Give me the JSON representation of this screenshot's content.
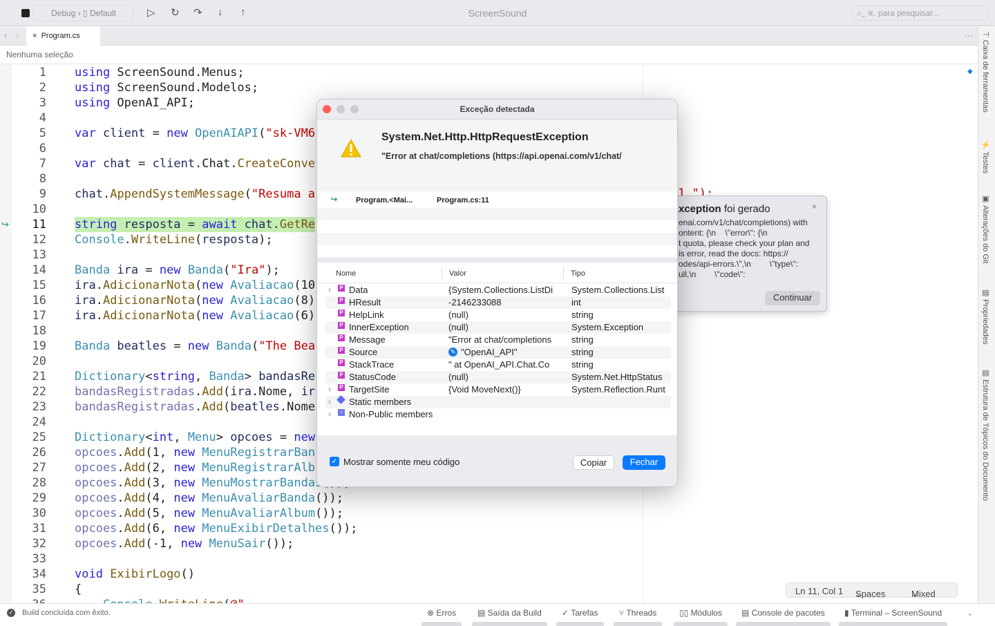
{
  "toolbar": {
    "config": "Debug",
    "device": "Default",
    "title": "ScreenSound",
    "search_placeholder": "⌘. para pesquisar..."
  },
  "tabs": [
    {
      "label": "Program.cs",
      "close": "×"
    }
  ],
  "breadcrumb": "Nenhuma seleção",
  "more_label": "···",
  "editor": {
    "current_line": 11,
    "line_numbers": [
      "1",
      "2",
      "3",
      "4",
      "5",
      "6",
      "7",
      "8",
      "9",
      "10",
      "11",
      "12",
      "13",
      "14",
      "15",
      "16",
      "17",
      "18",
      "19",
      "20",
      "21",
      "22",
      "23",
      "24",
      "25",
      "26",
      "27",
      "28",
      "29",
      "30",
      "31",
      "32",
      "33",
      "34",
      "35",
      "36"
    ],
    "lines": [
      [
        [
          "k",
          "using"
        ],
        [
          "n",
          " ScreenSound.Menus;"
        ]
      ],
      [
        [
          "k",
          "using"
        ],
        [
          "n",
          " ScreenSound.Modelos;"
        ]
      ],
      [
        [
          "k",
          "using"
        ],
        [
          "n",
          " OpenAI_API;"
        ]
      ],
      [],
      [
        [
          "k",
          "var"
        ],
        [
          "i",
          " client"
        ],
        [
          "p",
          " = "
        ],
        [
          "k",
          "new"
        ],
        [
          "t",
          " OpenAIAPI"
        ],
        [
          "p",
          "("
        ],
        [
          "s",
          "\"sk-VM6"
        ]
      ],
      [],
      [
        [
          "k",
          "var"
        ],
        [
          "i",
          " chat"
        ],
        [
          "p",
          " = "
        ],
        [
          "i",
          "client"
        ],
        [
          "p",
          ".Chat."
        ],
        [
          "m",
          "CreateConve"
        ]
      ],
      [],
      [
        [
          "i",
          "chat"
        ],
        [
          "p",
          "."
        ],
        [
          "m",
          "AppendSystemMessage"
        ],
        [
          "p",
          "("
        ],
        [
          "s",
          "\"Resuma a"
        ]
      ],
      [],
      [
        [
          "k",
          "string"
        ],
        [
          "i",
          " resposta"
        ],
        [
          "p",
          " = "
        ],
        [
          "k",
          "await"
        ],
        [
          "i",
          " chat"
        ],
        [
          "p",
          "."
        ],
        [
          "m",
          "GetRe"
        ]
      ],
      [
        [
          "t",
          "Console"
        ],
        [
          "p",
          "."
        ],
        [
          "m",
          "WriteLine"
        ],
        [
          "p",
          "("
        ],
        [
          "i",
          "resposta"
        ],
        [
          "p",
          ");"
        ]
      ],
      [],
      [
        [
          "t",
          "Banda"
        ],
        [
          "i",
          " ira"
        ],
        [
          "p",
          " = "
        ],
        [
          "k",
          "new"
        ],
        [
          "t",
          " Banda"
        ],
        [
          "p",
          "("
        ],
        [
          "s",
          "\"Ira\""
        ],
        [
          "p",
          ");"
        ]
      ],
      [
        [
          "i",
          "ira"
        ],
        [
          "p",
          "."
        ],
        [
          "m",
          "AdicionarNota"
        ],
        [
          "p",
          "("
        ],
        [
          "k",
          "new"
        ],
        [
          "t",
          " Avaliacao"
        ],
        [
          "p",
          "(10"
        ]
      ],
      [
        [
          "i",
          "ira"
        ],
        [
          "p",
          "."
        ],
        [
          "m",
          "AdicionarNota"
        ],
        [
          "p",
          "("
        ],
        [
          "k",
          "new"
        ],
        [
          "t",
          " Avaliacao"
        ],
        [
          "p",
          "(8)"
        ]
      ],
      [
        [
          "i",
          "ira"
        ],
        [
          "p",
          "."
        ],
        [
          "m",
          "AdicionarNota"
        ],
        [
          "p",
          "("
        ],
        [
          "k",
          "new"
        ],
        [
          "t",
          " Avaliacao"
        ],
        [
          "p",
          "(6)"
        ]
      ],
      [],
      [
        [
          "t",
          "Banda"
        ],
        [
          "i",
          " beatles"
        ],
        [
          "p",
          " = "
        ],
        [
          "k",
          "new"
        ],
        [
          "t",
          " Banda"
        ],
        [
          "p",
          "("
        ],
        [
          "s",
          "\"The Bea"
        ]
      ],
      [],
      [
        [
          "t",
          "Dictionary"
        ],
        [
          "p",
          "<"
        ],
        [
          "k",
          "string"
        ],
        [
          "p",
          ", "
        ],
        [
          "t",
          "Banda"
        ],
        [
          "p",
          "> "
        ],
        [
          "i",
          "bandasRe"
        ]
      ],
      [
        [
          "f",
          "bandasRegistradas"
        ],
        [
          "p",
          "."
        ],
        [
          "m",
          "Add"
        ],
        [
          "p",
          "("
        ],
        [
          "i",
          "ira"
        ],
        [
          "p",
          ".Nome, "
        ],
        [
          "i",
          "ir"
        ]
      ],
      [
        [
          "f",
          "bandasRegistradas"
        ],
        [
          "p",
          "."
        ],
        [
          "m",
          "Add"
        ],
        [
          "p",
          "("
        ],
        [
          "i",
          "beatles"
        ],
        [
          "p",
          ".Nome"
        ]
      ],
      [],
      [
        [
          "t",
          "Dictionary"
        ],
        [
          "p",
          "<"
        ],
        [
          "k",
          "int"
        ],
        [
          "p",
          ", "
        ],
        [
          "t",
          "Menu"
        ],
        [
          "p",
          "> "
        ],
        [
          "i",
          "opcoes"
        ],
        [
          "p",
          " = "
        ],
        [
          "k",
          "new"
        ]
      ],
      [
        [
          "f",
          "opcoes"
        ],
        [
          "p",
          "."
        ],
        [
          "m",
          "Add"
        ],
        [
          "p",
          "(1, "
        ],
        [
          "k",
          "new"
        ],
        [
          "t",
          " MenuRegistrarBan"
        ]
      ],
      [
        [
          "f",
          "opcoes"
        ],
        [
          "p",
          "."
        ],
        [
          "m",
          "Add"
        ],
        [
          "p",
          "(2, "
        ],
        [
          "k",
          "new"
        ],
        [
          "t",
          " MenuRegistrarAlb"
        ]
      ],
      [
        [
          "f",
          "opcoes"
        ],
        [
          "p",
          "."
        ],
        [
          "m",
          "Add"
        ],
        [
          "p",
          "(3, "
        ],
        [
          "k",
          "new"
        ],
        [
          "t",
          " MenuMostrarBandas"
        ],
        [
          "p",
          "());"
        ]
      ],
      [
        [
          "f",
          "opcoes"
        ],
        [
          "p",
          "."
        ],
        [
          "m",
          "Add"
        ],
        [
          "p",
          "(4, "
        ],
        [
          "k",
          "new"
        ],
        [
          "t",
          " MenuAvaliarBanda"
        ],
        [
          "p",
          "());"
        ]
      ],
      [
        [
          "f",
          "opcoes"
        ],
        [
          "p",
          "."
        ],
        [
          "m",
          "Add"
        ],
        [
          "p",
          "(5, "
        ],
        [
          "k",
          "new"
        ],
        [
          "t",
          " MenuAvaliarAlbum"
        ],
        [
          "p",
          "());"
        ]
      ],
      [
        [
          "f",
          "opcoes"
        ],
        [
          "p",
          "."
        ],
        [
          "m",
          "Add"
        ],
        [
          "p",
          "(6, "
        ],
        [
          "k",
          "new"
        ],
        [
          "t",
          " MenuExibirDetalhes"
        ],
        [
          "p",
          "());"
        ]
      ],
      [
        [
          "f",
          "opcoes"
        ],
        [
          "p",
          "."
        ],
        [
          "m",
          "Add"
        ],
        [
          "p",
          "(-1, "
        ],
        [
          "k",
          "new"
        ],
        [
          "t",
          " MenuSair"
        ],
        [
          "p",
          "());"
        ]
      ],
      [],
      [
        [
          "k",
          "void"
        ],
        [
          "m",
          " ExibirLogo"
        ],
        [
          "p",
          "()"
        ]
      ],
      [
        [
          "p",
          "{"
        ]
      ],
      [
        [
          "t",
          "    Console"
        ],
        [
          "p",
          "."
        ],
        [
          "m",
          "WriteLine"
        ],
        [
          "p",
          "("
        ],
        [
          "s",
          "@\""
        ]
      ]
    ],
    "overflow_fragment": "1 \");"
  },
  "dialog": {
    "title": "Exceção detectada",
    "exception_type": "System.Net.Http.HttpRequestException",
    "exception_message": "\"Error at chat/completions (https://api.openai.com/v1/chat/",
    "stack": [
      {
        "method": "Program.<Mai...",
        "location": "Program.cs:11"
      }
    ],
    "columns": [
      "Nome",
      "Valor",
      "Tipo"
    ],
    "rows": [
      {
        "name": "Data",
        "value": "{System.Collections.ListDi",
        "type": "System.Collections.List",
        "expandable": true,
        "icon": "property"
      },
      {
        "name": "HResult",
        "value": "-2146233088",
        "type": "int",
        "expandable": false,
        "icon": "property"
      },
      {
        "name": "HelpLink",
        "value": "(null)",
        "type": "string",
        "expandable": false,
        "icon": "property"
      },
      {
        "name": "InnerException",
        "value": "(null)",
        "type": "System.Exception",
        "expandable": false,
        "icon": "property"
      },
      {
        "name": "Message",
        "value": "\"Error at chat/completions",
        "type": "string",
        "expandable": false,
        "icon": "property"
      },
      {
        "name": "Source",
        "value": "\"OpenAI_API\"",
        "type": "string",
        "expandable": false,
        "icon": "property",
        "editable": true
      },
      {
        "name": "StackTrace",
        "value": "\"   at OpenAI_API.Chat.Co",
        "type": "string",
        "expandable": false,
        "icon": "property"
      },
      {
        "name": "StatusCode",
        "value": "(null)",
        "type": "System.Net.HttpStatus",
        "expandable": false,
        "icon": "property"
      },
      {
        "name": "TargetSite",
        "value": "{Void MoveNext()}",
        "type": "System.Reflection.Runt",
        "expandable": true,
        "icon": "property"
      },
      {
        "name": "Static members",
        "value": "",
        "type": "",
        "expandable": true,
        "icon": "class"
      },
      {
        "name": "Non-Public members",
        "value": "",
        "type": "",
        "expandable": true,
        "icon": "field"
      }
    ],
    "checkbox_label": "Mostrar somente meu código",
    "checkbox_checked": true,
    "copy_label": "Copiar",
    "close_label": "Fechar"
  },
  "popup": {
    "title_bold": "xception",
    "title_rest": " foi gerado",
    "lines": [
      "enai.com/v1/chat/completions) with",
      "ontent: {\\n    \\\"error\\\": {\\n",
      "t quota, please check your plan and",
      "is error, read the docs: https://",
      "odes/api-errors.\\\",\\n        \\\"type\\\":",
      "ull,\\n        \\\"code\\\":"
    ],
    "continue_label": "Continuar"
  },
  "right_sidebar": [
    "Caixa de ferramentas",
    "Testes",
    "Alterações do Git",
    "Propriedades",
    "Estrutura de Tópicos do Documento"
  ],
  "position": {
    "cursor": "Ln 11, Col 1",
    "indent": "Spaces",
    "line_endings": "Mixed"
  },
  "status": {
    "message": "Build concluída com êxito."
  },
  "bottom_tabs": [
    "Erros",
    "Saída da Build",
    "Tarefas",
    "Threads",
    "Módulos",
    "Console de pacotes",
    "Terminal – ScreenSound"
  ],
  "colors": {
    "accent": "#0a7bff",
    "current_line": "#c5efb2",
    "keyword": "#2a22d8",
    "type": "#3a8fb0",
    "string": "#c00000",
    "close_light": "#ff5f57"
  }
}
